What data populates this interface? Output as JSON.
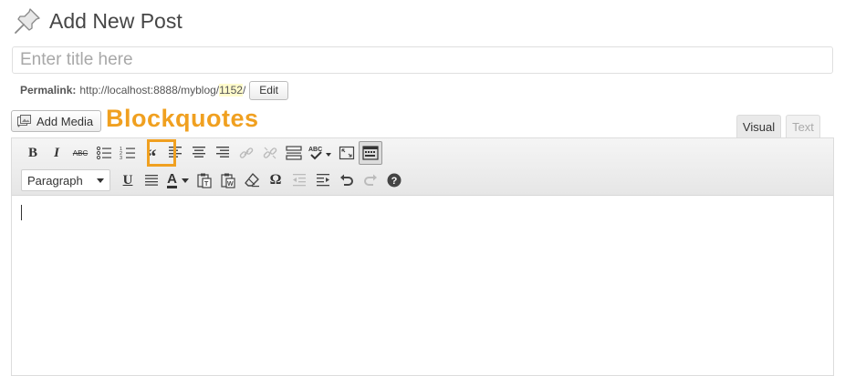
{
  "page": {
    "title": "Add New Post"
  },
  "post_title": {
    "placeholder": "Enter title here",
    "value": ""
  },
  "permalink": {
    "label": "Permalink:",
    "base_url": "http://localhost:8888/myblog/",
    "post_id": "1152",
    "trailing_slash": "/",
    "edit_label": "Edit"
  },
  "media": {
    "add_media_label": "Add Media"
  },
  "annotation": {
    "label": "Blockquotes",
    "color": "#f0a020"
  },
  "editor_tabs": [
    {
      "label": "Visual",
      "active": true
    },
    {
      "label": "Text",
      "active": false
    }
  ],
  "toolbar": {
    "row1": [
      {
        "icon": "bold-icon",
        "glyph": "B"
      },
      {
        "icon": "italic-icon",
        "glyph": "I"
      },
      {
        "icon": "strikethrough-icon",
        "glyph": "ABC"
      },
      {
        "icon": "bullet-list-icon"
      },
      {
        "icon": "numbered-list-icon"
      },
      {
        "icon": "blockquote-icon",
        "glyph": "“",
        "highlighted": true
      },
      {
        "icon": "align-left-icon"
      },
      {
        "icon": "align-center-icon"
      },
      {
        "icon": "align-right-icon"
      },
      {
        "icon": "insert-link-icon"
      },
      {
        "icon": "remove-link-icon"
      },
      {
        "icon": "read-more-icon"
      },
      {
        "icon": "spellcheck-icon",
        "glyph": "ABC"
      },
      {
        "icon": "fullscreen-icon"
      },
      {
        "icon": "kitchen-sink-icon",
        "active": true
      }
    ],
    "row2": [
      {
        "icon": "format-select",
        "value": "Paragraph"
      },
      {
        "icon": "underline-icon",
        "glyph": "U"
      },
      {
        "icon": "justify-icon"
      },
      {
        "icon": "text-color-icon",
        "glyph": "A"
      },
      {
        "icon": "paste-text-icon"
      },
      {
        "icon": "paste-word-icon",
        "glyph": "W"
      },
      {
        "icon": "clear-formatting-icon"
      },
      {
        "icon": "special-character-icon",
        "glyph": "Ω"
      },
      {
        "icon": "outdent-icon"
      },
      {
        "icon": "indent-icon"
      },
      {
        "icon": "undo-icon"
      },
      {
        "icon": "redo-icon"
      },
      {
        "icon": "help-icon",
        "glyph": "?"
      }
    ]
  },
  "colors": {
    "accent": "#f0a020",
    "permalink_highlight": "#fffbcc"
  }
}
